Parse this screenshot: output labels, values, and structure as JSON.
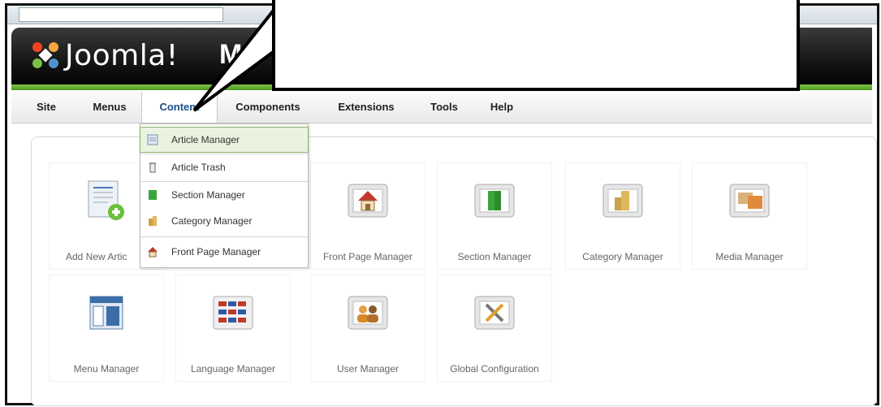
{
  "header": {
    "logo_text": "Joomla!",
    "truncated_title": "M"
  },
  "menu": {
    "items": [
      {
        "label": "Site"
      },
      {
        "label": "Menus"
      },
      {
        "label": "Content"
      },
      {
        "label": "Components"
      },
      {
        "label": "Extensions"
      },
      {
        "label": "Tools"
      },
      {
        "label": "Help"
      }
    ],
    "active": "Content"
  },
  "dropdown": {
    "items": [
      {
        "label": "Article Manager",
        "icon": "article-icon",
        "highlighted": true
      },
      {
        "label": "Article Trash",
        "icon": "trash-icon"
      },
      {
        "label": "Section Manager",
        "icon": "section-icon"
      },
      {
        "label": "Category Manager",
        "icon": "category-icon"
      },
      {
        "label": "Front Page Manager",
        "icon": "frontpage-icon"
      }
    ]
  },
  "control_panel": {
    "row1": [
      {
        "label": "Add New Artic",
        "icon": "add-article-icon"
      },
      {
        "label": "Front Page Manager",
        "icon": "frontpage-icon"
      },
      {
        "label": "Section Manager",
        "icon": "section-icon"
      },
      {
        "label": "Category Manager",
        "icon": "category-icon"
      },
      {
        "label": "Media Manager",
        "icon": "media-icon"
      }
    ],
    "row2": [
      {
        "label": "Menu Manager",
        "icon": "menu-icon"
      },
      {
        "label": "Language Manager",
        "icon": "language-icon"
      },
      {
        "label": "User Manager",
        "icon": "users-icon"
      },
      {
        "label": "Global Configuration",
        "icon": "config-icon"
      }
    ]
  },
  "colors": {
    "header_dark": "#141414",
    "header_green": "#7ac143",
    "highlight_bg": "#eaf3df",
    "highlight_border": "#8cb06b"
  }
}
